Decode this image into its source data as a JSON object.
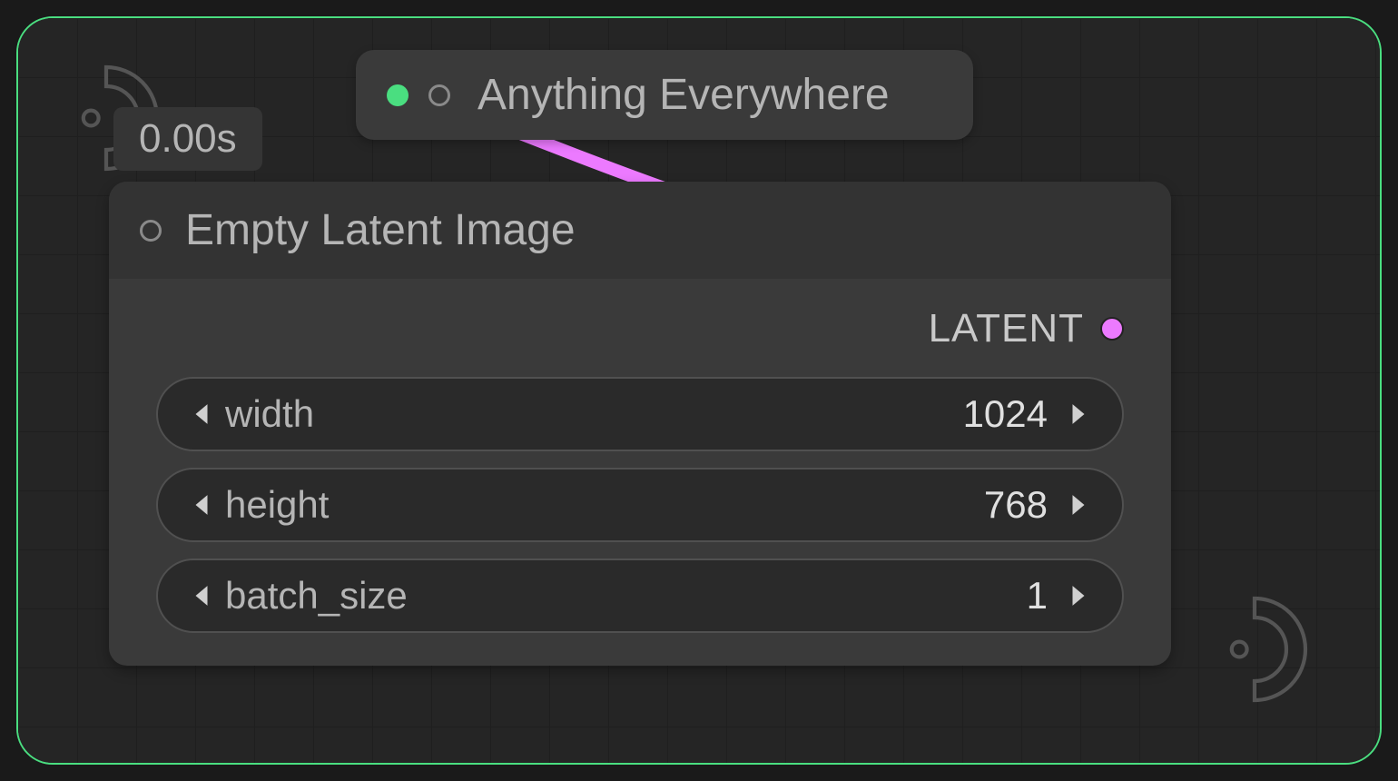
{
  "timer": "0.00s",
  "colors": {
    "accent_green": "#4ade80",
    "wire_pink": "#ec7aff"
  },
  "nodes": {
    "anything_everywhere": {
      "title": "Anything Everywhere"
    },
    "empty_latent_image": {
      "title": "Empty Latent Image",
      "output_label": "LATENT",
      "widgets": [
        {
          "label": "width",
          "value": "1024"
        },
        {
          "label": "height",
          "value": "768"
        },
        {
          "label": "batch_size",
          "value": "1"
        }
      ]
    }
  }
}
